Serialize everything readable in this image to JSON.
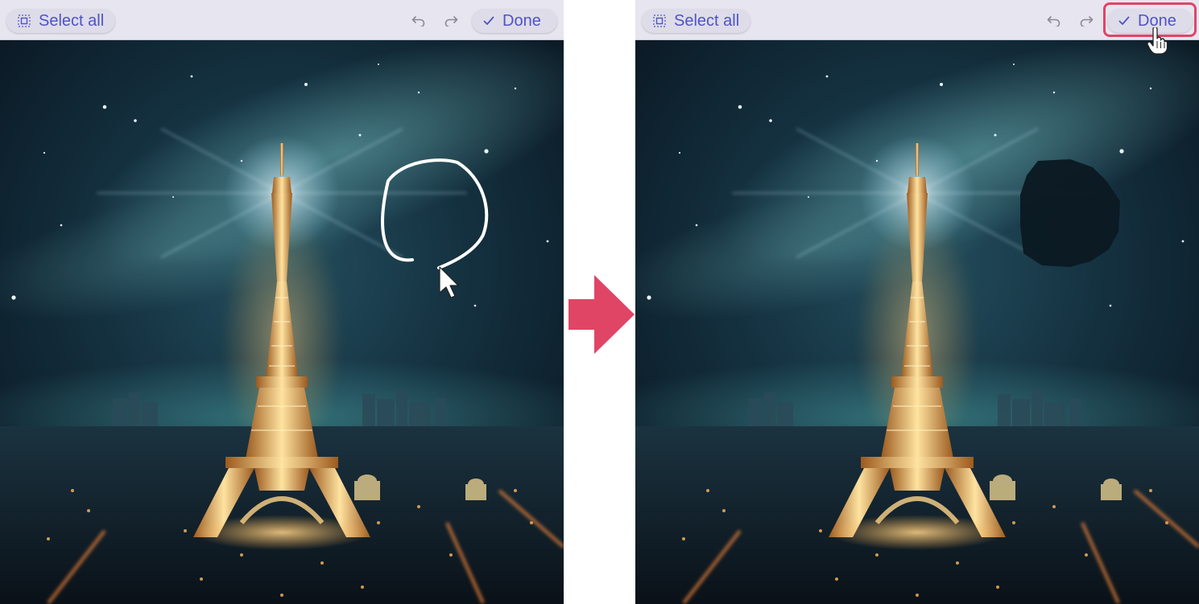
{
  "left_panel": {
    "toolbar": {
      "select_all_label": "Select all",
      "done_label": "Done",
      "undo_icon": "undo-icon",
      "redo_icon": "redo-icon"
    },
    "scene": "eiffel-tower-night-with-hand-drawn-circle"
  },
  "right_panel": {
    "toolbar": {
      "select_all_label": "Select all",
      "done_label": "Done",
      "undo_icon": "undo-icon",
      "redo_icon": "redo-icon"
    },
    "scene": "eiffel-tower-night-with-erased-area"
  },
  "colors": {
    "accent": "#4e53c9",
    "toolbar_bg": "#e7e5ef",
    "pill_bg": "#dedce9",
    "arrow": "#e04566",
    "highlight": "#e04566",
    "sky_dark": "#0c1a26",
    "tower_glow": "#ffc864"
  }
}
